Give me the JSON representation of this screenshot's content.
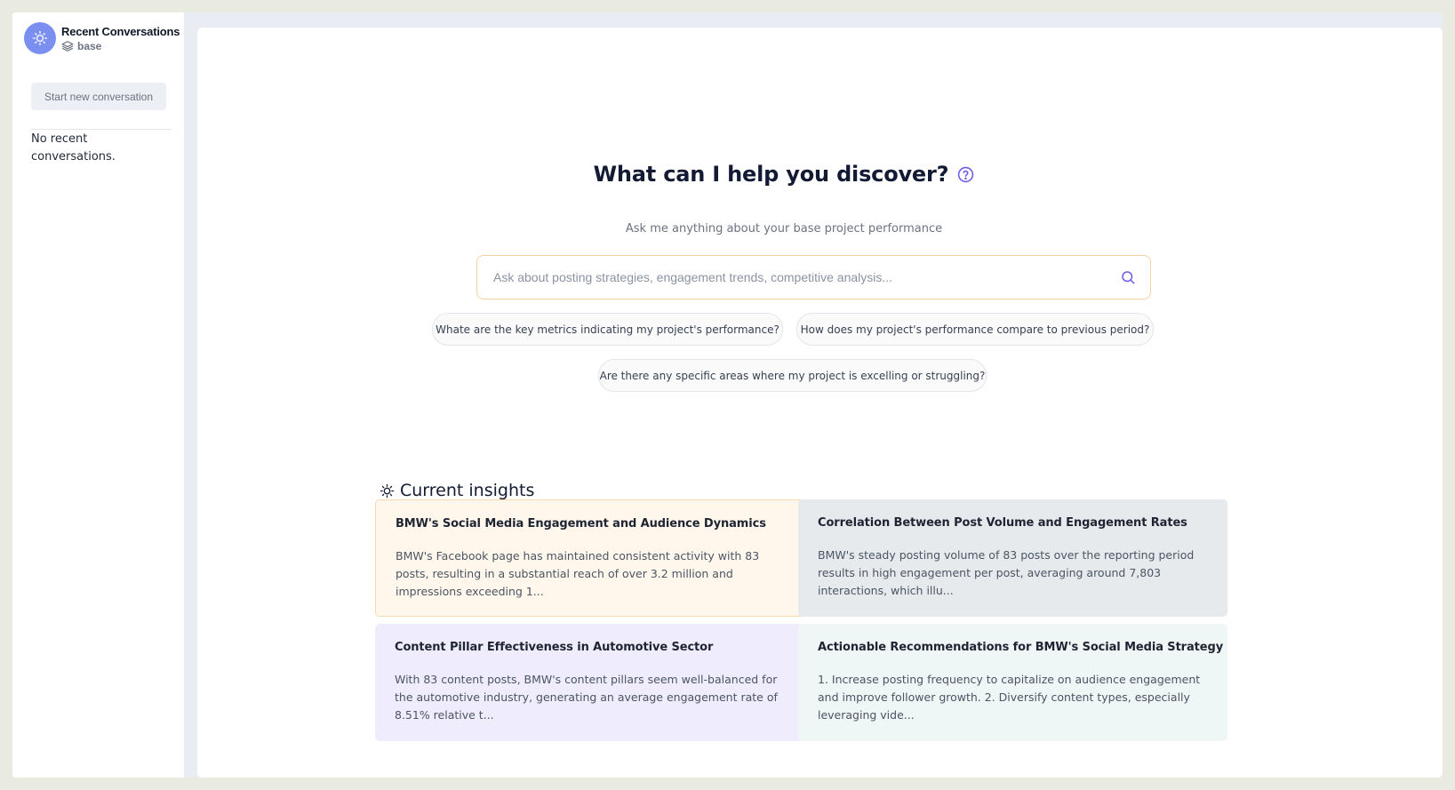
{
  "sidebar": {
    "title": "Recent Conversations",
    "project": "base",
    "new_conversation_label": "Start new conversation",
    "empty_text": "No recent conversations."
  },
  "main": {
    "heading": "What can I help you discover?",
    "subheading": "Ask me anything about your base project performance",
    "search": {
      "placeholder": "Ask about posting strategies, engagement trends, competitive analysis...",
      "value": ""
    },
    "suggestions": [
      "Whate are the key metrics indicating my project's performance?",
      "How does my project's performance compare to previous period?",
      "Are there any specific areas where my project is excelling or struggling?"
    ],
    "insights": {
      "title": "Current insights",
      "cards": [
        {
          "title": "BMW's Social Media Engagement and Audience Dynamics",
          "body": "BMW's Facebook page has maintained consistent activity with 83 posts, resulting in a substantial reach of over 3.2 million and impressions exceeding 1...",
          "color": "#fff7ec"
        },
        {
          "title": "Correlation Between Post Volume and Engagement Rates",
          "body": "BMW's steady posting volume of 83 posts over the reporting period results in high engagement per post, averaging around 7,803 interactions, which illu...",
          "color": "#e7eaed"
        },
        {
          "title": "Content Pillar Effectiveness in Automotive Sector",
          "body": "With 83 content posts, BMW's content pillars seem well-balanced for the automotive industry, generating an average engagement rate of 8.51% relative t...",
          "color": "#efecfd"
        },
        {
          "title": "Actionable Recommendations for BMW's Social Media Strategy",
          "body": "1. Increase posting frequency to capitalize on audience engagement and improve follower growth. 2. Diversify content types, especially leveraging vide...",
          "color": "#eff6f6"
        }
      ]
    }
  },
  "colors": {
    "accent": "#6d5ce7",
    "avatar": "#7b8ff0",
    "search_border": "#f3d3a5",
    "card1_border": "#f6d9ad"
  },
  "icons": {
    "brand": "sun-bulb-icon",
    "project": "layers-icon",
    "help": "question-circle-icon",
    "search": "search-icon",
    "insights": "sun-bulb-icon"
  }
}
